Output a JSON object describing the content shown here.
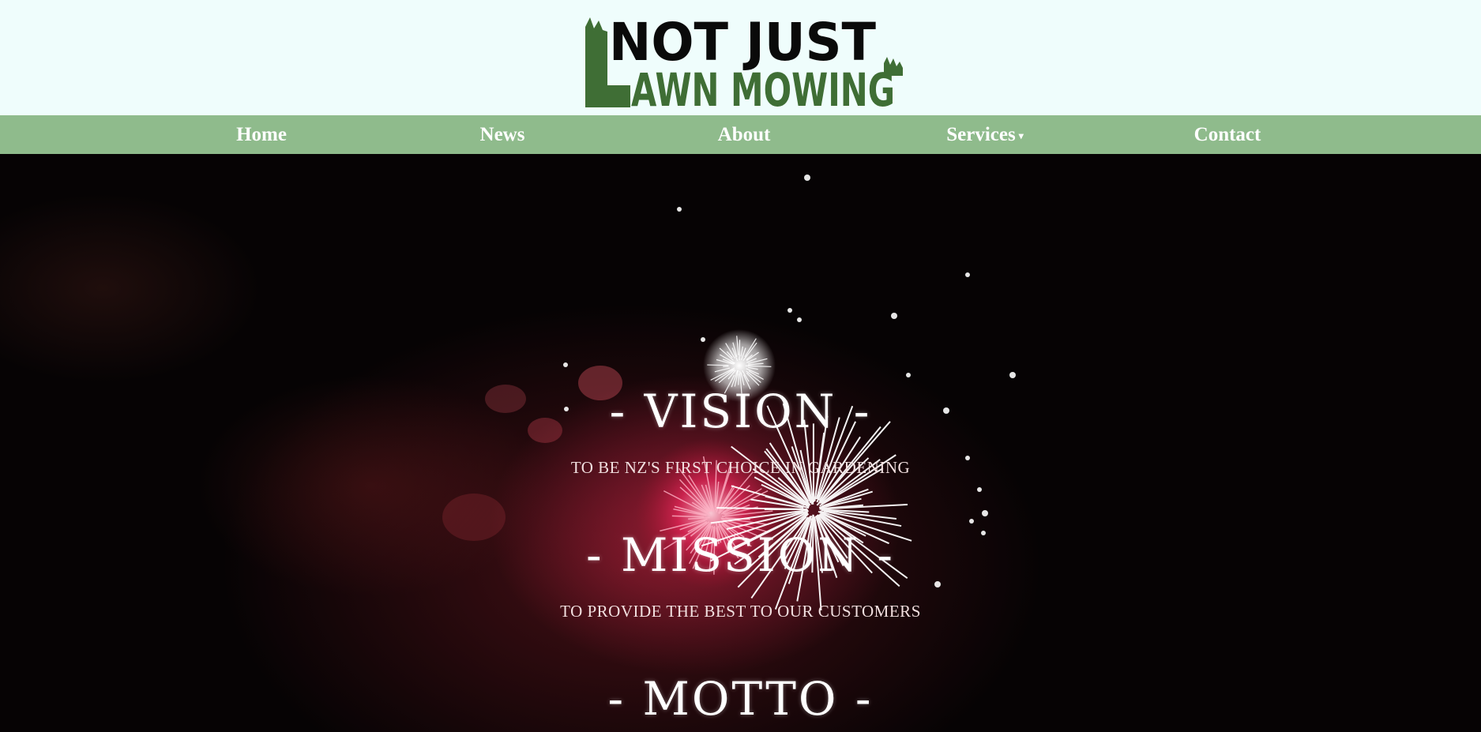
{
  "brand": {
    "logo_line1": "NOT JUST",
    "logo_line2": "AWN MOWING",
    "logo_initial": "L",
    "logo_green": "#3f6e35"
  },
  "nav": {
    "items": [
      {
        "label": "Home"
      },
      {
        "label": "News"
      },
      {
        "label": "About"
      },
      {
        "label": "Services",
        "has_dropdown": true
      },
      {
        "label": "Contact"
      }
    ],
    "background": "#8fbb8c"
  },
  "hero": {
    "background_image": "fireworks",
    "vision_title": "- VISION -",
    "vision_text": "TO BE NZ'S FIRST CHOICE IN GARDENING",
    "mission_title": "- MISSION -",
    "mission_text": "TO PROVIDE THE BEST TO OUR CUSTOMERS",
    "motto_title": "- MOTTO -"
  }
}
